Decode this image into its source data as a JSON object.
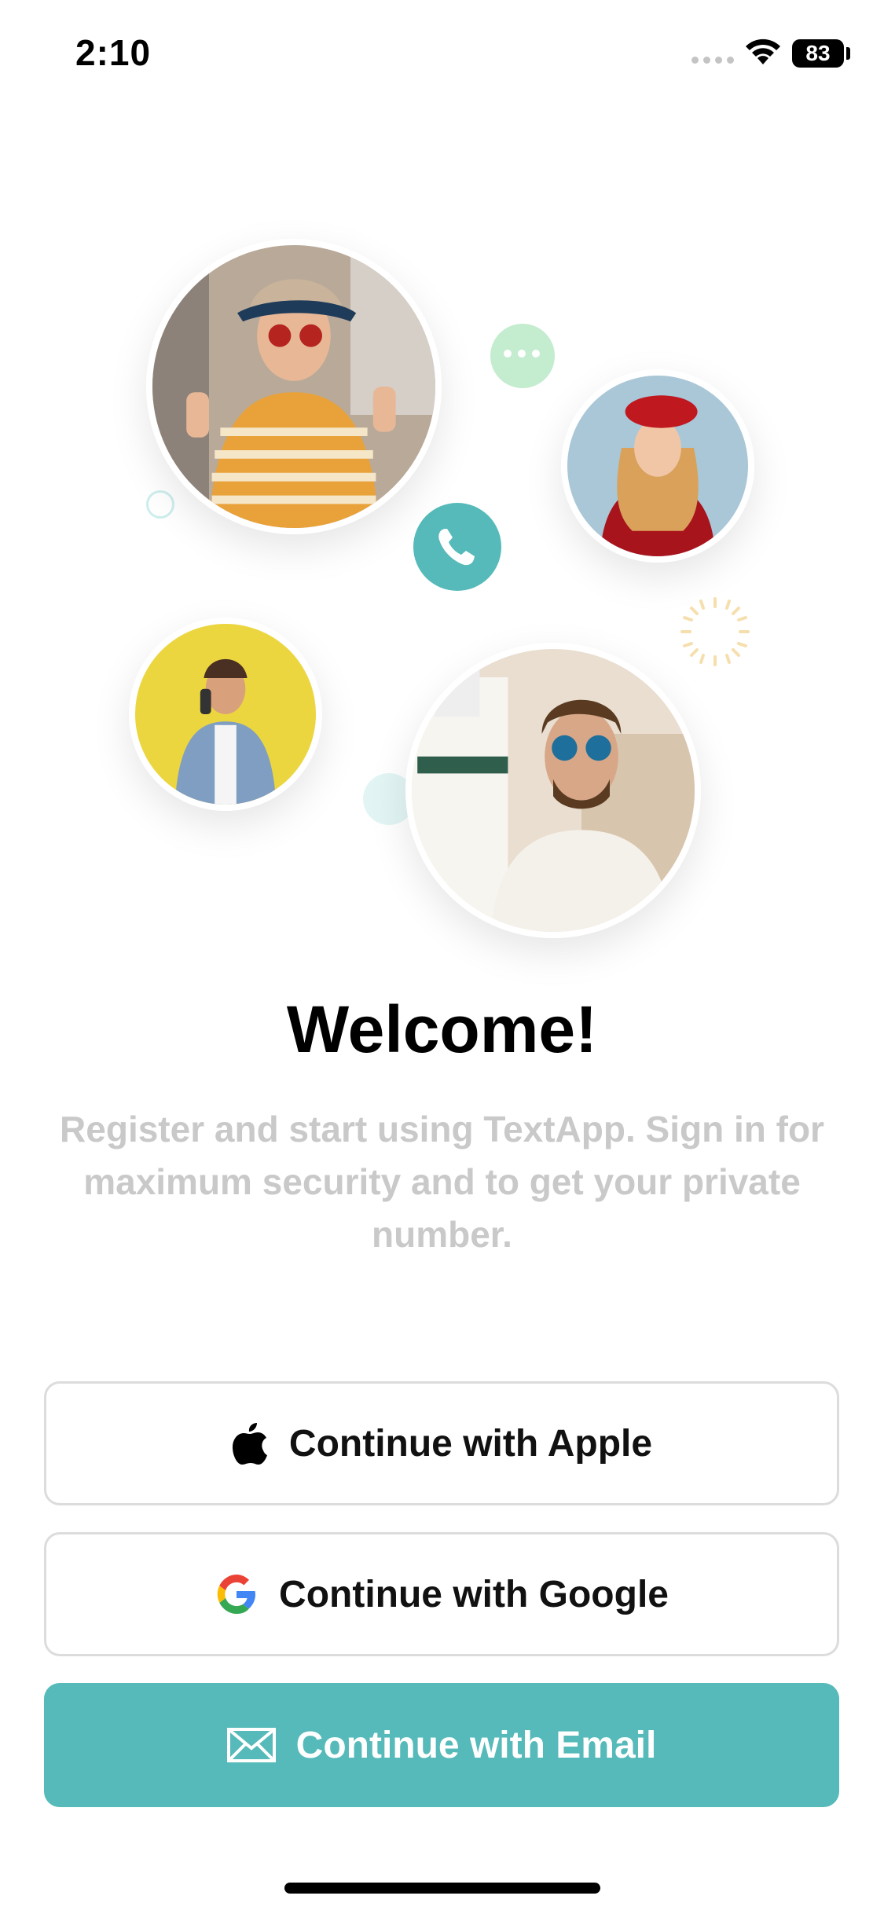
{
  "status_bar": {
    "time": "2:10",
    "battery": "83"
  },
  "welcome": {
    "title": "Welcome!",
    "subtitle": "Register and start using TextApp. Sign in for maximum security and to get your private number."
  },
  "buttons": {
    "apple": {
      "label": "Continue with Apple",
      "icon": "apple-icon"
    },
    "google": {
      "label": "Continue with Google",
      "icon": "google-icon"
    },
    "email": {
      "label": "Continue with Email",
      "icon": "mail-icon"
    }
  },
  "colors": {
    "accent": "#55bab9",
    "chat_bubble": "#c4eccf",
    "subtitle_text": "#c9c9c9",
    "button_border": "#dcdcdc"
  }
}
